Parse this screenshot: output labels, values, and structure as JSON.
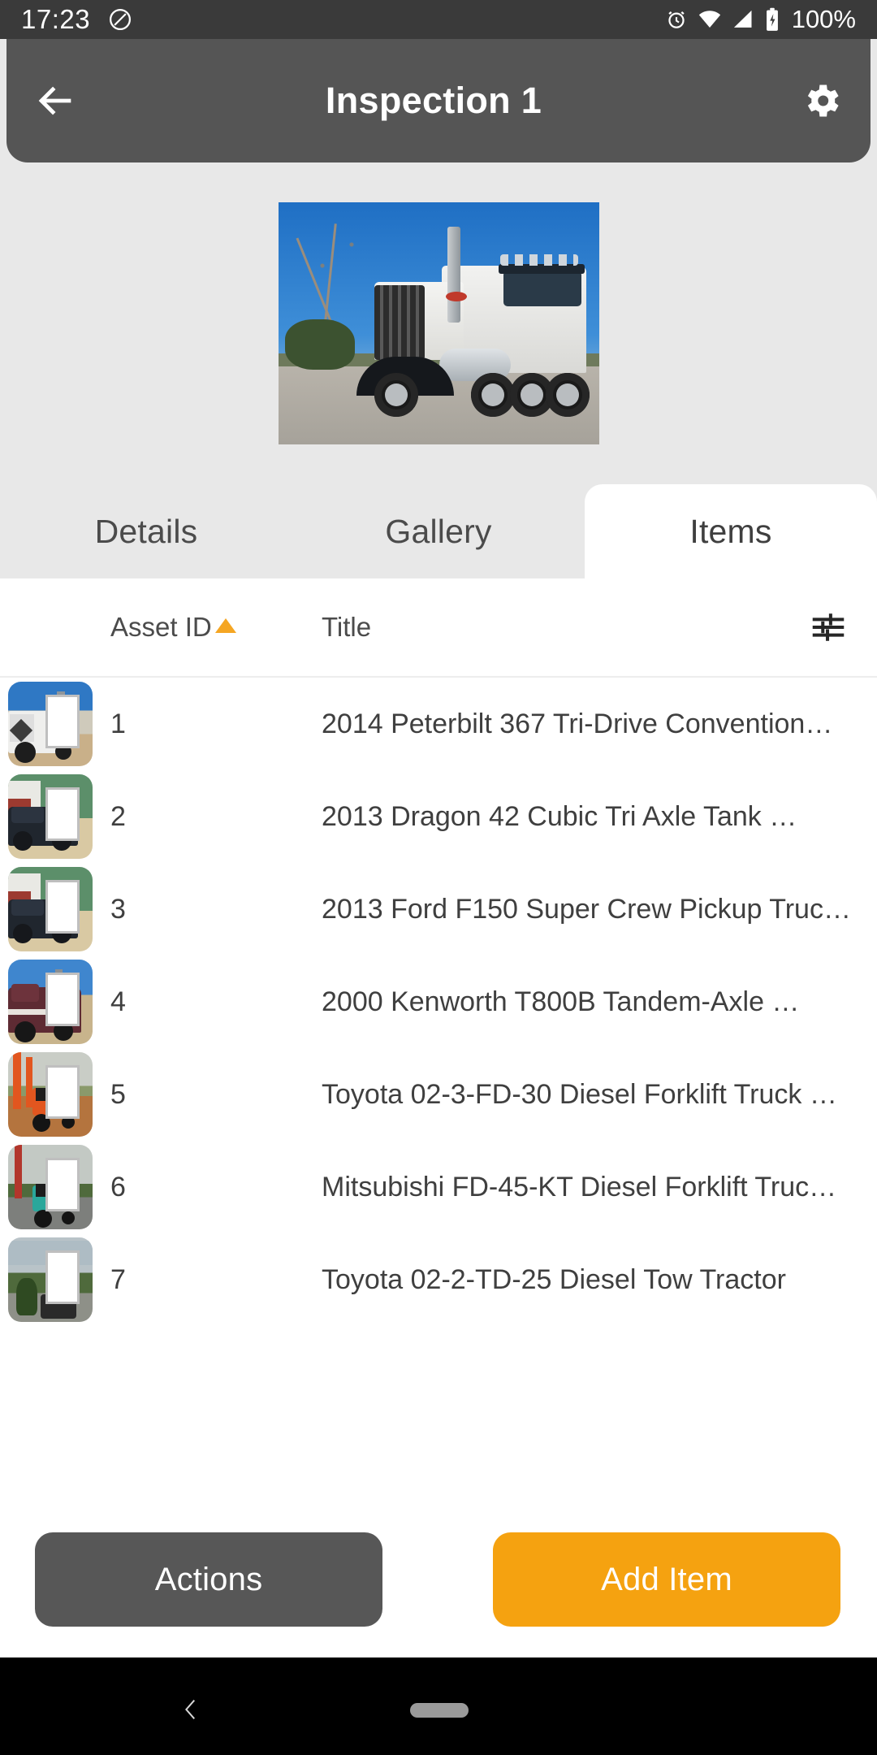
{
  "statusbar": {
    "time": "17:23",
    "battery_percent": "100%",
    "icons": [
      "dnd-circle-slash-icon",
      "alarm-icon",
      "wifi-icon",
      "cell-signal-icon",
      "battery-charging-icon"
    ]
  },
  "appbar": {
    "back_icon": "arrow-left-icon",
    "title": "Inspection 1",
    "settings_icon": "gear-icon",
    "bg_color": "#555555"
  },
  "hero": {
    "alt": "2014 Peterbilt 367 Tri-Drive Conventional Truck Tractor photo"
  },
  "tabs": [
    {
      "label": "Details",
      "active": false
    },
    {
      "label": "Gallery",
      "active": false
    },
    {
      "label": "Items",
      "active": true
    }
  ],
  "table": {
    "columns": {
      "thumbnail": "",
      "asset_id": "Asset ID",
      "title": "Title"
    },
    "sort": {
      "column": "Asset ID",
      "direction": "ascending",
      "indicator": "▲",
      "color": "#f5a623"
    },
    "filter_icon": "tune-filter-icon",
    "rows": [
      {
        "asset_id": "1",
        "title": "2014 Peterbilt 367 Tri-Drive Convention…",
        "thumb": "white-peterbilt-truck"
      },
      {
        "asset_id": "2",
        "title": "2013 Dragon 42 Cubic Tri Axle Tank …",
        "thumb": "black-ford-pickup"
      },
      {
        "asset_id": "3",
        "title": "2013 Ford F150 Super Crew Pickup Truc…",
        "thumb": "black-ford-pickup"
      },
      {
        "asset_id": "4",
        "title": "2000 Kenworth T800B Tandem-Axle …",
        "thumb": "maroon-kenworth-truck"
      },
      {
        "asset_id": "5",
        "title": "Toyota 02-3-FD-30 Diesel Forklift Truck …",
        "thumb": "orange-forklift"
      },
      {
        "asset_id": "6",
        "title": "Mitsubishi FD-45-KT Diesel Forklift Truc…",
        "thumb": "teal-forklift"
      },
      {
        "asset_id": "7",
        "title": "Toyota 02-2-TD-25 Diesel Tow Tractor",
        "thumb": "grey-tow-tractor"
      }
    ]
  },
  "footer": {
    "actions_label": "Actions",
    "add_item_label": "Add Item",
    "actions_color": "#575757",
    "add_item_color": "#f5a210"
  },
  "navbar": {
    "back_icon": "nav-back-chevron-icon",
    "home_icon": "nav-home-pill-icon"
  }
}
